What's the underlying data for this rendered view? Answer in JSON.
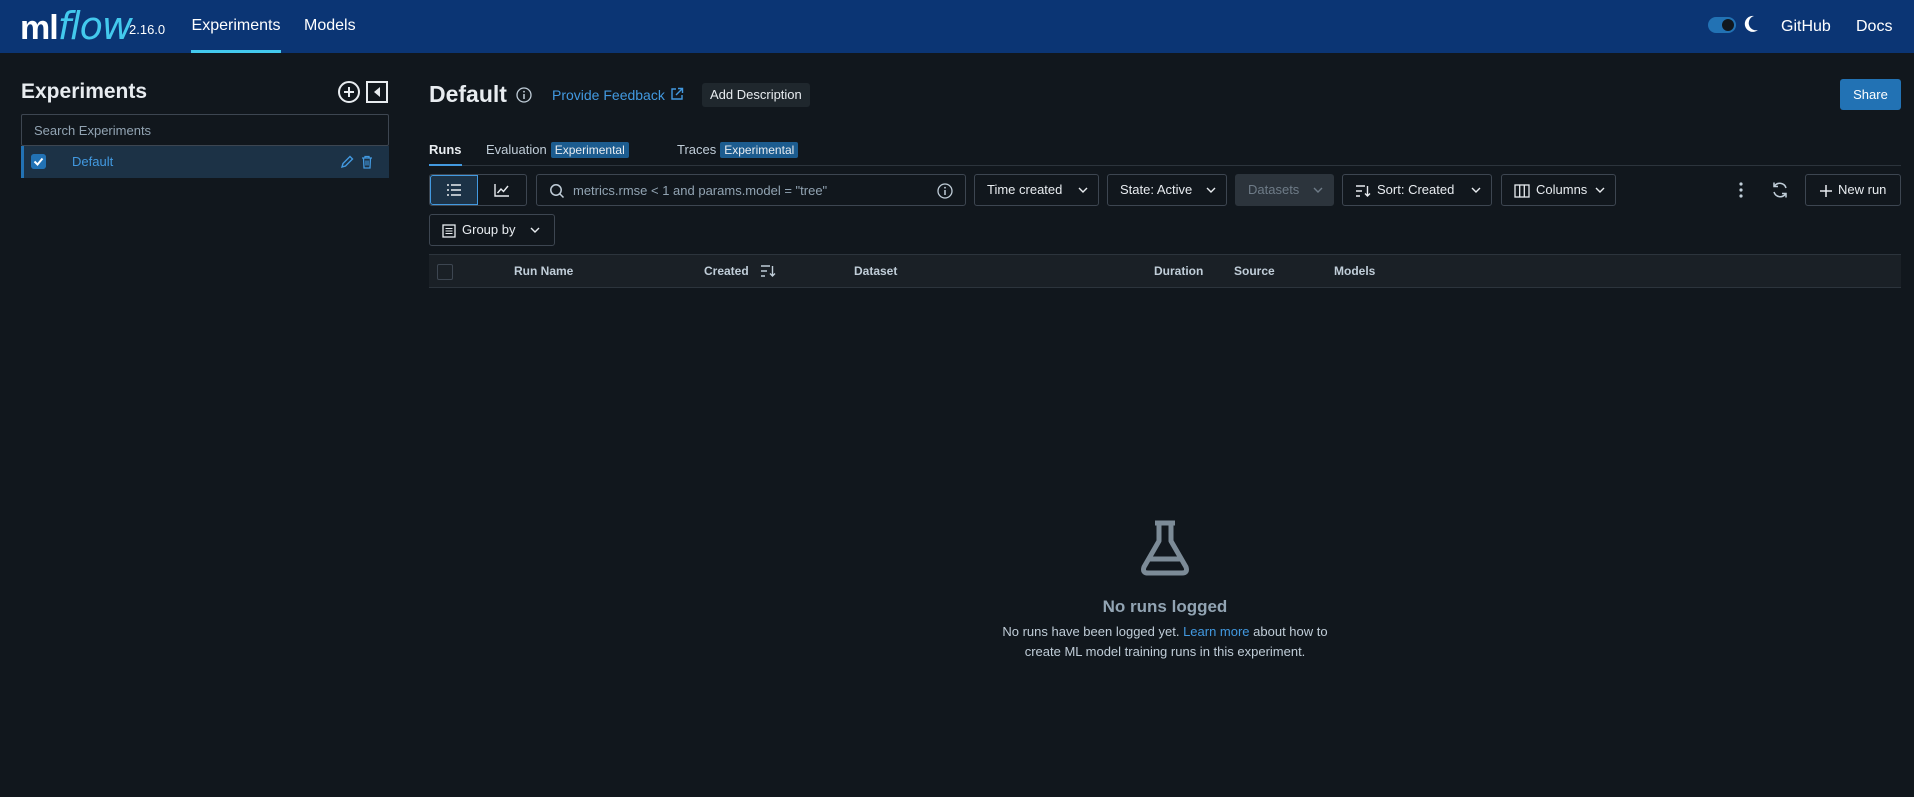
{
  "app": {
    "logo_ml": "ml",
    "logo_flow": "flow",
    "version": "2.16.0",
    "nav": [
      {
        "label": "Experiments"
      },
      {
        "label": "Models"
      }
    ],
    "github": "GitHub",
    "docs": "Docs",
    "dark_mode": true
  },
  "sidebar": {
    "title": "Experiments",
    "search_placeholder": "Search Experiments",
    "experiments": [
      {
        "name": "Default",
        "checked": true
      }
    ]
  },
  "main": {
    "title": "Default",
    "feedback_label": "Provide Feedback",
    "add_description_label": "Add Description",
    "share_label": "Share",
    "tabs": [
      {
        "label": "Runs",
        "active": true
      },
      {
        "label": "Evaluation",
        "badge": "Experimental"
      },
      {
        "label": "Traces",
        "badge": "Experimental"
      }
    ]
  },
  "toolbar": {
    "filter_placeholder": "metrics.rmse < 1 and params.model = \"tree\"",
    "time_label": "Time created",
    "state_label": "State: Active",
    "datasets_label": "Datasets",
    "sort_label": "Sort: Created",
    "columns_label": "Columns",
    "new_run_label": "New run",
    "group_by_label": "Group by"
  },
  "table": {
    "columns": [
      "Run Name",
      "Created",
      "Dataset",
      "Duration",
      "Source",
      "Models"
    ]
  },
  "empty_state": {
    "title": "No runs logged",
    "text_before": "No runs have been logged yet. ",
    "link": "Learn more",
    "text_after": " about how to create ML model training runs in this experiment."
  },
  "colors": {
    "topbar": "#0b3574",
    "accent": "#43c9ed",
    "primary": "#2272b4",
    "link": "#4299e0",
    "background": "#11171d"
  }
}
